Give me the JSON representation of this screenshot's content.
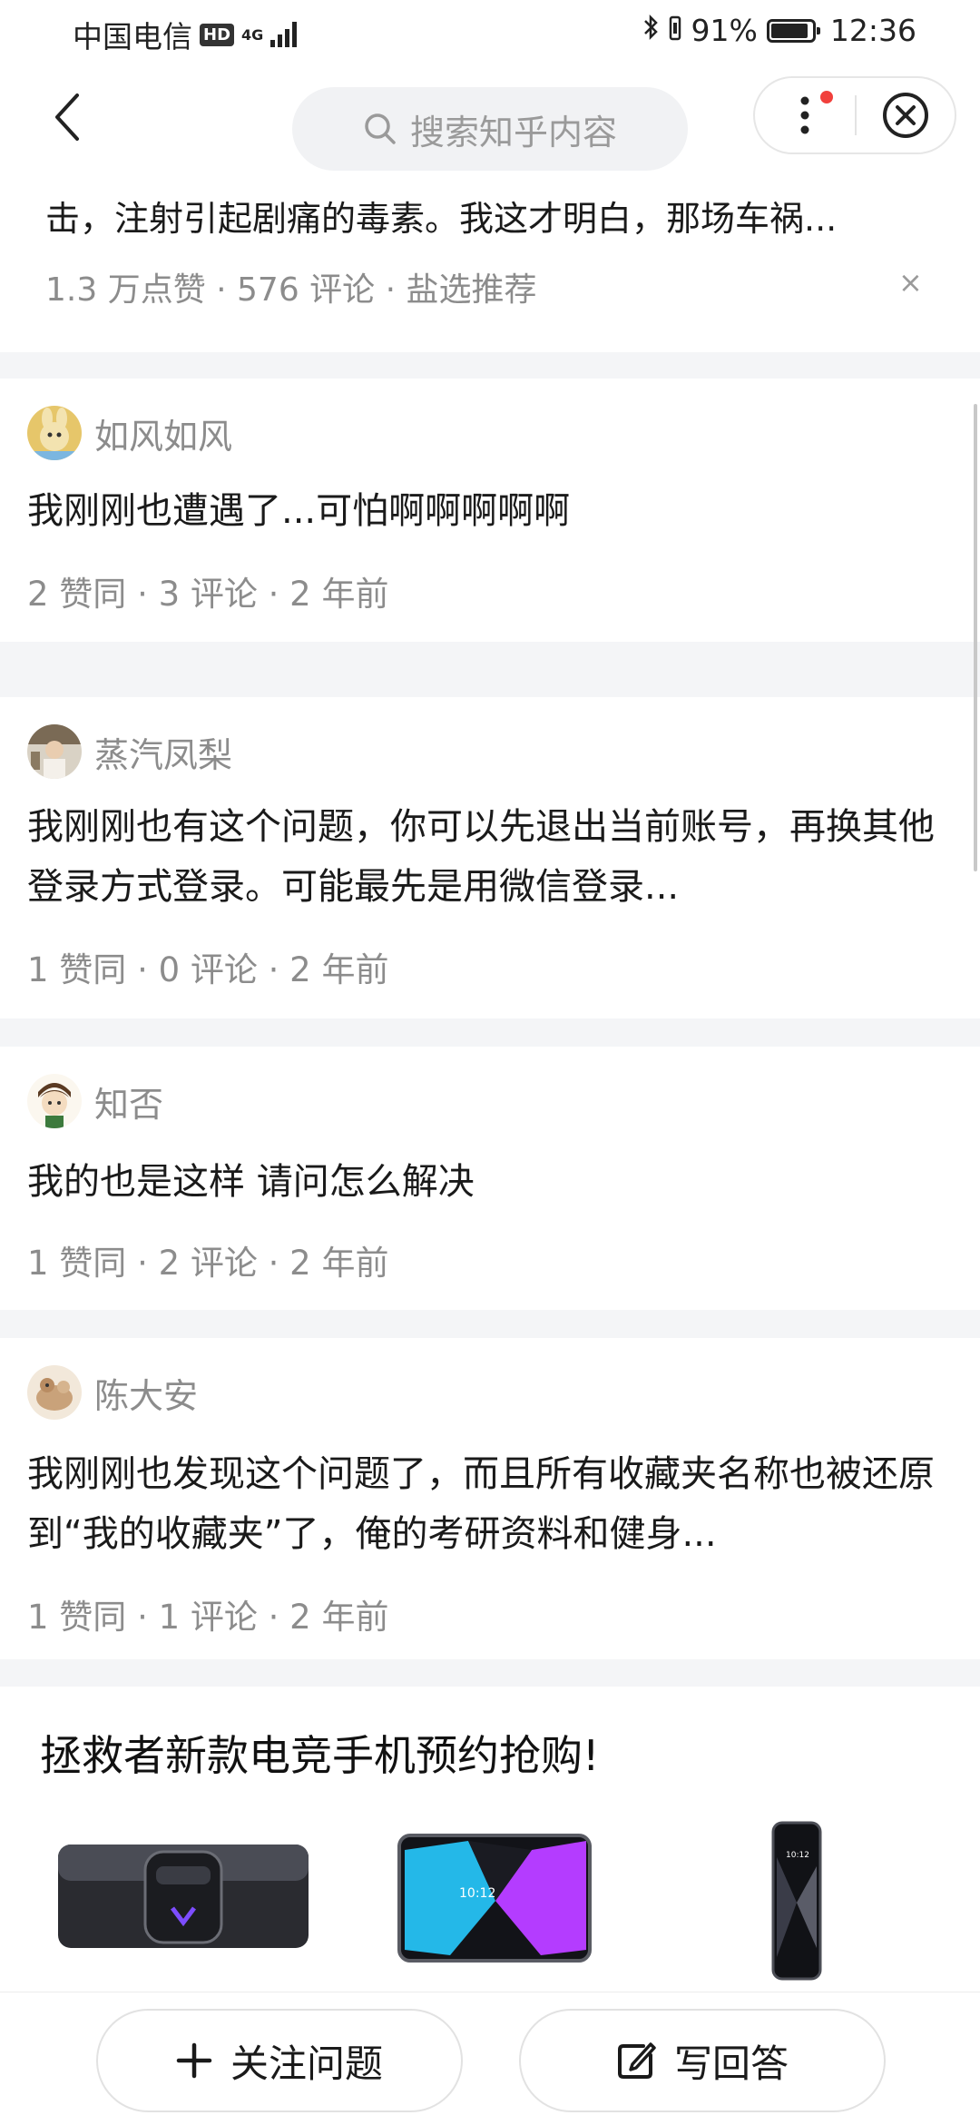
{
  "status_bar": {
    "carrier": "中国电信",
    "hd": "HD",
    "network": "4G",
    "battery": "91%",
    "battery_level": 0.91,
    "time": "12:36"
  },
  "nav": {
    "search_placeholder": "搜索知乎内容"
  },
  "recommended": {
    "snippet": "击，注射引起剧痛的毒素。我这才明白，那场车祸...",
    "meta": "1.3 万点赞 · 576 评论 · 盐选推荐",
    "close": "×"
  },
  "comments": [
    {
      "name": "如风如风",
      "text": "我刚刚也遭遇了...可怕啊啊啊啊啊",
      "meta": "2 赞同 · 3 评论 · 2 年前"
    },
    {
      "name": "蒸汽凤梨",
      "text": "我刚刚也有这个问题，你可以先退出当前账号，再换其他登录方式登录。可能最先是用微信登录...",
      "meta": "1 赞同 · 0 评论 · 2 年前"
    },
    {
      "name": "知否",
      "text": "我的也是这样 请问怎么解决",
      "meta": "1 赞同 · 2 评论 · 2 年前"
    },
    {
      "name": "陈大安",
      "text": "我刚刚也发现这个问题了，而且所有收藏夹名称也被还原到“我的收藏夹”了，俺的考研资料和健身...",
      "meta": "1 赞同 · 1 评论 · 2 年前"
    }
  ],
  "ad": {
    "title": "拯救者新款电竞手机预约抢购!",
    "phone_screen_time": "10:12"
  },
  "bottom": {
    "follow_label": "关注问题",
    "answer_label": "写回答"
  }
}
